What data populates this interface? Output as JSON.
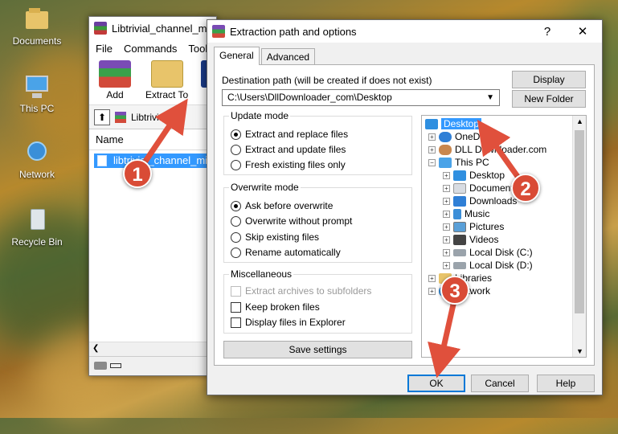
{
  "desktop": {
    "icons": [
      {
        "label": "Documents",
        "icon": "folder-icon"
      },
      {
        "label": "This PC",
        "icon": "computer-icon"
      },
      {
        "label": "Network",
        "icon": "network-icon"
      },
      {
        "label": "Recycle Bin",
        "icon": "recycle-bin-icon"
      }
    ]
  },
  "winrar": {
    "title": "Libtrivial_channel_m",
    "menu": [
      "File",
      "Commands",
      "Tools"
    ],
    "toolbar": {
      "add": "Add",
      "extract_to": "Extract To",
      "partial": "T"
    },
    "address": "Libtrivial_ch",
    "column_name": "Name",
    "file_name": "libtrivial_channel_mi"
  },
  "dialog": {
    "title": "Extraction path and options",
    "help_glyph": "?",
    "close_glyph": "✕",
    "tabs": [
      "General",
      "Advanced"
    ],
    "destination_label": "Destination path (will be created if does not exist)",
    "destination_value": "C:\\Users\\DllDownloader_com\\Desktop",
    "display_button": "Display",
    "new_folder_button": "New Folder",
    "update_mode": {
      "title": "Update mode",
      "options": [
        "Extract and replace files",
        "Extract and update files",
        "Fresh existing files only"
      ],
      "selected": 0
    },
    "overwrite_mode": {
      "title": "Overwrite mode",
      "options": [
        "Ask before overwrite",
        "Overwrite without prompt",
        "Skip existing files",
        "Rename automatically"
      ],
      "selected": 0
    },
    "misc": {
      "title": "Miscellaneous",
      "options": [
        "Extract archives to subfolders",
        "Keep broken files",
        "Display files in Explorer"
      ]
    },
    "save_settings": "Save settings",
    "tree": [
      {
        "label": "Desktop",
        "selected": true
      },
      {
        "label": "OneDrive"
      },
      {
        "label": "DLL Downloader.com"
      },
      {
        "label": "This PC"
      },
      {
        "label": "Desktop"
      },
      {
        "label": "Documents"
      },
      {
        "label": "Downloads"
      },
      {
        "label": "Music"
      },
      {
        "label": "Pictures"
      },
      {
        "label": "Videos"
      },
      {
        "label": "Local Disk (C:)"
      },
      {
        "label": "Local Disk (D:)"
      },
      {
        "label": "Libraries"
      },
      {
        "label": "Network"
      }
    ],
    "ok": "OK",
    "cancel": "Cancel",
    "help": "Help"
  },
  "annotations": {
    "step1": "1",
    "step2": "2",
    "step3": "3"
  },
  "colors": {
    "badge": "#d94b36",
    "selection": "#3399ff",
    "arrow": "#e0503c"
  }
}
